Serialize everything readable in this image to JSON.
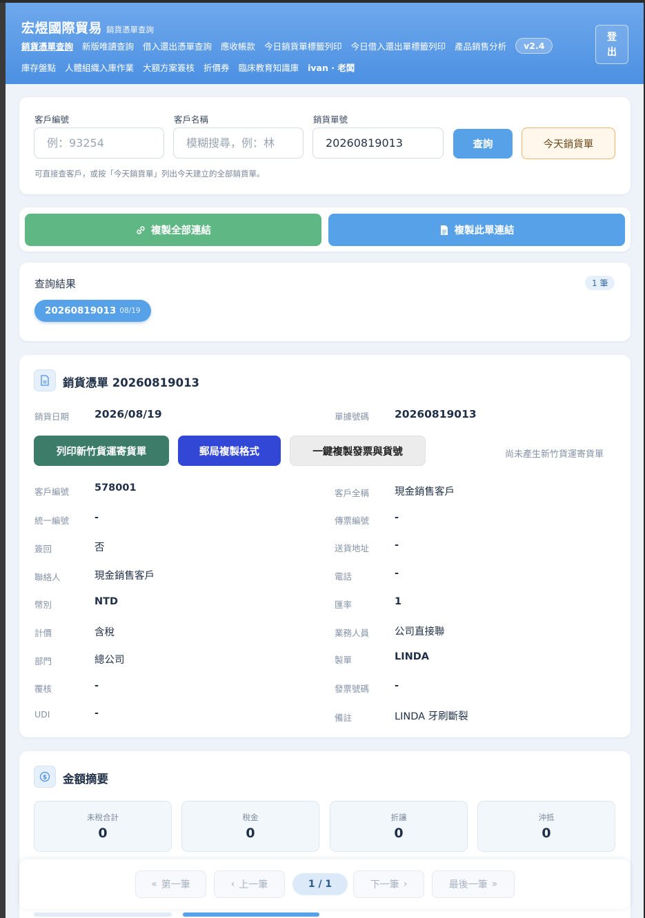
{
  "header": {
    "brand_title": "宏煜國際貿易",
    "brand_subtitle": "銷貨憑單查詢",
    "nav_row1": [
      "銷貨憑單查詢",
      "新版唯讀查詢",
      "借入還出憑單查詢",
      "應收帳款",
      "今日銷貨單標籤列印",
      "今日借入還出單標籤列印",
      "產品銷售分析"
    ],
    "version": "v2.4",
    "nav_row2": [
      "庫存盤點",
      "人體組織入庫作業",
      "大額方案簽核",
      "折價券",
      "臨床教育知識庫"
    ],
    "user": "ivan · 老闆",
    "logout_line1": "登",
    "logout_line2": "出"
  },
  "search": {
    "customer_code_label": "客戶編號",
    "customer_code_placeholder": "例：93254",
    "customer_name_label": "客戶名稱",
    "customer_name_placeholder": "模糊搜尋，例：林",
    "order_no_label": "銷貨單號",
    "order_no_value": "20260819013",
    "query_button": "查詢",
    "today_button": "今天銷貨單",
    "hint": "可直接查客戶，或按「今天銷貨單」列出今天建立的全部銷貨單。"
  },
  "copy_bar": {
    "copy_all": "複製全部連結",
    "copy_this": "複製此單連結"
  },
  "results": {
    "title": "查詢結果",
    "count": "1 筆",
    "chip_number": "20260819013",
    "chip_date": "08/19"
  },
  "voucher": {
    "title": "銷貨憑單 20260819013",
    "date_label": "銷貨日期",
    "date_value": "2026/08/19",
    "doc_no_label": "單據號碼",
    "doc_no_value": "20260819013",
    "btn_print_hct": "列印新竹貨運寄貨單",
    "btn_post_copy": "郵局複製格式",
    "btn_copy_invoice": "一鍵複製發票與貨號",
    "hct_status": "尚未產生新竹貨運寄貨單",
    "left": [
      {
        "label": "客戶編號",
        "value": "578001"
      },
      {
        "label": "統一編號",
        "value": "-"
      },
      {
        "label": "簽回",
        "value": "否"
      },
      {
        "label": "聯絡人",
        "value": "現金銷售客戶"
      },
      {
        "label": "幣別",
        "value": "NTD"
      },
      {
        "label": "計價",
        "value": "含稅"
      },
      {
        "label": "部門",
        "value": "總公司"
      },
      {
        "label": "覆核",
        "value": "-"
      },
      {
        "label": "UDI",
        "value": "-"
      }
    ],
    "right": [
      {
        "label": "客戶全稱",
        "value": "現金銷售客戶"
      },
      {
        "label": "傳票編號",
        "value": "-"
      },
      {
        "label": "送貨地址",
        "value": "-"
      },
      {
        "label": "電話",
        "value": "-"
      },
      {
        "label": "匯率",
        "value": "1"
      },
      {
        "label": "業務人員",
        "value": "公司直接聯"
      },
      {
        "label": "製單",
        "value": "LINDA"
      },
      {
        "label": "發票號碼",
        "value": "-"
      },
      {
        "label": "備註",
        "value": "LINDA 牙刷斷裂"
      }
    ]
  },
  "summary": {
    "title": "金額摘要",
    "items": [
      {
        "label": "未稅合計",
        "value": "0"
      },
      {
        "label": "稅金",
        "value": "0"
      },
      {
        "label": "折讓",
        "value": "0"
      },
      {
        "label": "沖抵",
        "value": "0"
      }
    ]
  },
  "pager": {
    "first": "第一筆",
    "prev": "上一筆",
    "current": "1 / 1",
    "next": "下一筆",
    "last": "最後一筆"
  },
  "colors": {
    "header_blue": "#4c90e2",
    "green": "#5fb784",
    "blue_button": "#56a1e8",
    "dark_green": "#3e7c6a",
    "indigo": "#3347d6",
    "orange_border": "#f0b56a"
  }
}
